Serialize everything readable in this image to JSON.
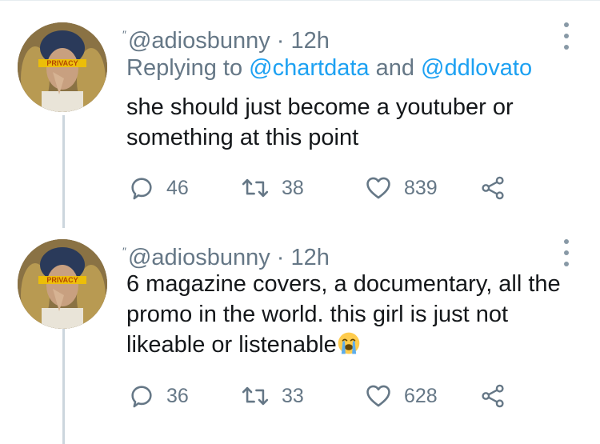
{
  "colors": {
    "text_primary": "#14171a",
    "text_secondary": "#657786",
    "link": "#1da1f2",
    "thread_line": "#ccd6dd"
  },
  "tweets": [
    {
      "handle": "@adiosbunny",
      "separator": " · ",
      "time": "12h",
      "replying_prefix": "Replying to ",
      "replying_mention_1": "@chartdata",
      "replying_and": " and ",
      "replying_mention_2": "@ddlovato",
      "text": "she should just become a youtuber or something at this point",
      "emoji": "",
      "avatar_overlay_text": "PRIVACY",
      "actions": {
        "replies": "46",
        "retweets": "38",
        "likes": "839"
      },
      "icons": [
        "reply-icon",
        "retweet-icon",
        "heart-icon",
        "share-icon",
        "more-icon"
      ]
    },
    {
      "handle": "@adiosbunny",
      "separator": " · ",
      "time": "12h",
      "text": "6 magazine covers, a documentary, all the promo in the world. this girl is just not likeable or listenable",
      "emoji": "loudly-crying-face",
      "avatar_overlay_text": "PRIVACY",
      "actions": {
        "replies": "36",
        "retweets": "33",
        "likes": "628"
      },
      "icons": [
        "reply-icon",
        "retweet-icon",
        "heart-icon",
        "share-icon",
        "more-icon"
      ]
    }
  ]
}
